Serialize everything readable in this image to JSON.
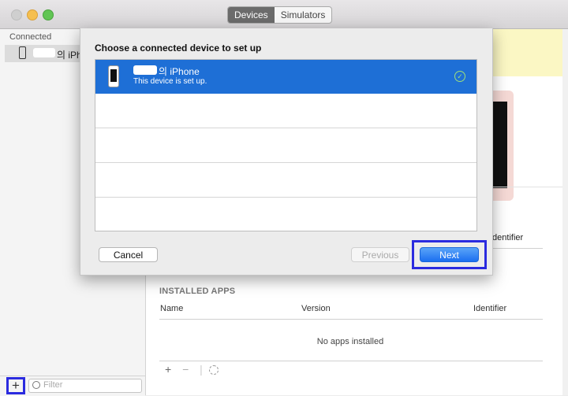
{
  "toolbar": {
    "tabs": [
      {
        "label": "Devices",
        "active": true
      },
      {
        "label": "Simulators",
        "active": false
      }
    ]
  },
  "sidebar": {
    "section_header": "Connected",
    "items": [
      {
        "label": "의 iPhone"
      }
    ],
    "filter_placeholder": "Filter"
  },
  "main": {
    "identifier_label": "Identifier",
    "installed_apps": {
      "title": "INSTALLED APPS",
      "columns": [
        "Name",
        "Version",
        "Identifier"
      ],
      "empty_text": "No apps installed",
      "toolbar": {
        "add": "+",
        "remove": "−",
        "separator": "|"
      }
    }
  },
  "dialog": {
    "title": "Choose a connected device to set up",
    "devices": [
      {
        "name": "의 iPhone",
        "status": "This device is set up.",
        "selected": true
      }
    ],
    "empty_rows": 4,
    "buttons": {
      "cancel": "Cancel",
      "previous": "Previous",
      "next": "Next"
    }
  },
  "colors": {
    "selection": "#1e6fd6",
    "highlight_box": "#2b2bdf",
    "accent_button": "#1b6ff0"
  }
}
